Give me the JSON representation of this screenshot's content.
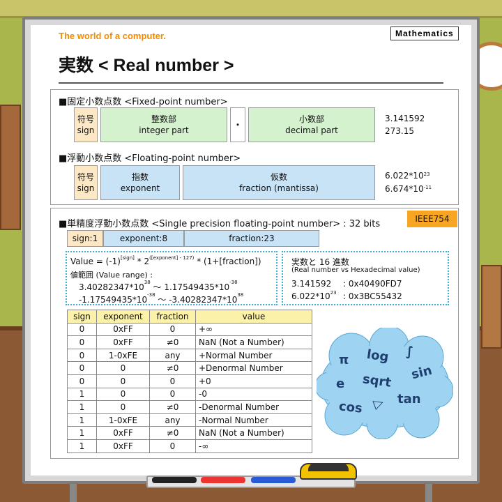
{
  "header": {
    "subtitle": "The world of a computer.",
    "topic": "Mathematics",
    "title": "実数 < Real number >"
  },
  "fixed": {
    "heading": "■固定小数点数 <Fixed-point number>",
    "sign_jp": "符号",
    "sign_en": "sign",
    "int_jp": "整数部",
    "int_en": "integer part",
    "dot": "・",
    "dec_jp": "小数部",
    "dec_en": "decimal part",
    "examples": [
      "3.141592",
      "273.15"
    ]
  },
  "floating": {
    "heading": "■浮動小数点数 <Floating-point number>",
    "sign_jp": "符号",
    "sign_en": "sign",
    "exp_jp": "指数",
    "exp_en": "exponent",
    "frac_jp": "仮数",
    "frac_en": "fraction (mantissa)",
    "ex1_base": "6.022*10",
    "ex1_exp": "23",
    "ex2_base": "6.674*10",
    "ex2_exp": "-11"
  },
  "single": {
    "heading": "■単精度浮動小数点数 <Single precision floating-point number> : 32 bits",
    "badge": "IEEE754",
    "fmt_sign": "sign:1",
    "fmt_exp": "exponent:8",
    "fmt_frac": "fraction:23",
    "value_prefix": "Value = (-1)",
    "value_sign": "[sign]",
    "value_mid": " * 2",
    "value_exp": "([exponent] - 127)",
    "value_suffix": " * (1+[fraction])",
    "range_label": "値範囲 (Value range) :",
    "range1_a": "3.40282347*10",
    "range1_a_exp": "38",
    "range1_b": " ～ 1.17549435*10",
    "range1_b_exp": "-38",
    "range2_a": "-1.17549435*10",
    "range2_a_exp": "-38",
    "range2_b": " ～ -3.40282347*10",
    "range2_b_exp": "38",
    "hex_title": "実数と 16 進数",
    "hex_subtitle": "(Real number vs Hexadecimal value)",
    "hex1_real": "3.141592",
    "hex1_val": ": 0x40490FD7",
    "hex2_base": "6.022*10",
    "hex2_exp": "23",
    "hex2_val": ": 0x3BC55432"
  },
  "table": {
    "headers": [
      "sign",
      "exponent",
      "fraction",
      "value"
    ],
    "rows": [
      [
        "0",
        "0xFF",
        "0",
        "+∞"
      ],
      [
        "0",
        "0xFF",
        "≠0",
        "NaN (Not a Number)"
      ],
      [
        "0",
        "1-0xFE",
        "any",
        "+Normal Number"
      ],
      [
        "0",
        "0",
        "≠0",
        "+Denormal Number"
      ],
      [
        "0",
        "0",
        "0",
        "+0"
      ],
      [
        "1",
        "0",
        "0",
        "-0"
      ],
      [
        "1",
        "0",
        "≠0",
        "-Denormal Number"
      ],
      [
        "1",
        "1-0xFE",
        "any",
        "-Normal Number"
      ],
      [
        "1",
        "0xFF",
        "≠0",
        "NaN (Not a Number)"
      ],
      [
        "1",
        "0xFF",
        "0",
        "-∞"
      ]
    ]
  },
  "cloud_words": {
    "pi": "π",
    "log": "log",
    "integral": "∫",
    "e": "e",
    "sqrt": "sqrt",
    "sin": "sin",
    "cos": "cos",
    "triangle": "▷",
    "tan": "tan"
  },
  "colors": {
    "orange": "#f28c00",
    "sign_fill": "#fce8c5",
    "green_fill": "#d5f2cf",
    "blue_fill": "#c8e2f6",
    "badge_fill": "#f6a623",
    "header_fill": "#fcf1a8",
    "cloud_fill": "#9fd3f2"
  }
}
